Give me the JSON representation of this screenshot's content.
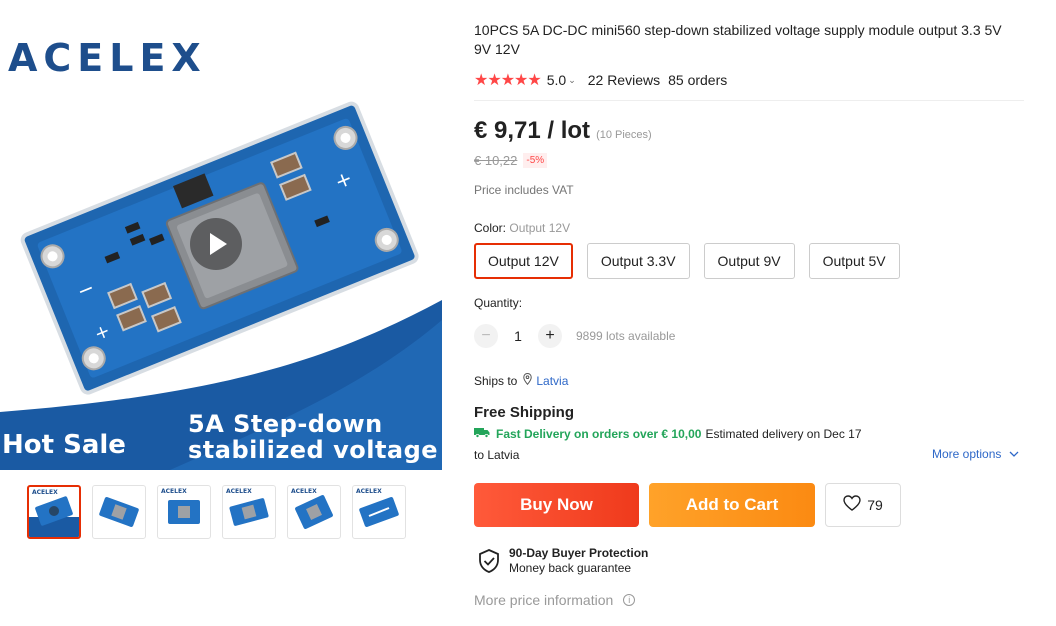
{
  "brand": {
    "logo_text": "ACELEX"
  },
  "gallery": {
    "hero_line1": "5A Step-down",
    "hero_line2": "stabilized voltage",
    "hero_badge": "Hot Sale",
    "thumbnails": [
      {
        "alt": "thumbnail-1",
        "active": true
      },
      {
        "alt": "thumbnail-2",
        "active": false
      },
      {
        "alt": "thumbnail-3",
        "active": false
      },
      {
        "alt": "thumbnail-4",
        "active": false
      },
      {
        "alt": "thumbnail-5",
        "active": false
      },
      {
        "alt": "thumbnail-6",
        "active": false
      }
    ]
  },
  "product": {
    "title": "10PCS 5A DC-DC mini560 step-down stabilized voltage supply module output 3.3 5V 9V 12V",
    "rating": {
      "stars": "★★★★★",
      "value": "5.0",
      "dropdown": "⌄",
      "reviews": "22 Reviews",
      "orders": "85 orders"
    },
    "price": {
      "current": "€ 9,71 / lot",
      "unit": "(10 Pieces)",
      "original": "€ 10,22",
      "discount": "-5%",
      "vat_note": "Price includes VAT"
    },
    "color": {
      "label": "Color:",
      "selected": "Output 12V",
      "options": [
        "Output 12V",
        "Output 3.3V",
        "Output 9V",
        "Output 5V"
      ]
    },
    "quantity": {
      "label": "Quantity:",
      "value": "1",
      "minus": "−",
      "plus": "+",
      "available": "9899 lots available"
    },
    "shipping": {
      "ships_to_label": "Ships to",
      "ships_to_country": "Latvia",
      "free_shipping": "Free Shipping",
      "fast_delivery": "Fast Delivery on orders over € 10,00",
      "estimated": "Estimated delivery on Dec 17",
      "to_country": "to Latvia",
      "more_options": "More options"
    },
    "actions": {
      "buy_now": "Buy Now",
      "add_to_cart": "Add to Cart",
      "wishlist_count": "79"
    },
    "protection": {
      "title": "90-Day Buyer Protection",
      "subtitle": "Money back guarantee"
    },
    "more_price_info": "More price information"
  },
  "colors": {
    "accent_red": "#e62e04",
    "buy_now": "#ff4d2d",
    "add_to_cart": "#fb9216",
    "star": "#ff4747",
    "link_blue": "#2e68c8",
    "delivery_green": "#23a55a",
    "pcb_blue": "#1e66b0"
  }
}
